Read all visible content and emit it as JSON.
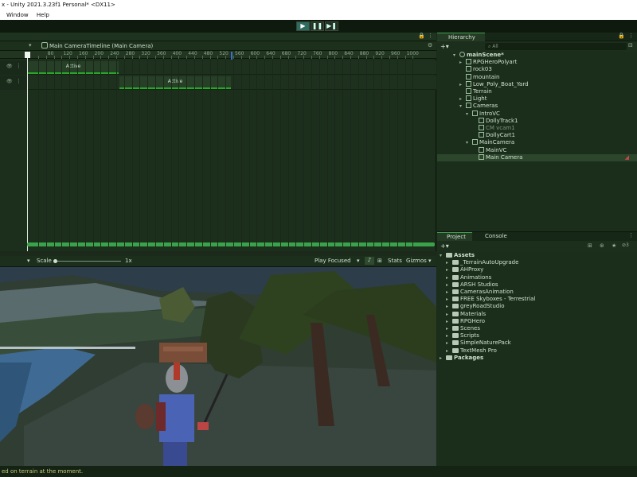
{
  "window": {
    "title": "x - Unity 2021.3.23f1 Personal* <DX11>"
  },
  "menu": {
    "items": [
      "Window",
      "Help"
    ]
  },
  "toolbar": {
    "play_icon": "play-icon",
    "pause_icon": "pause-icon",
    "step_icon": "step-icon"
  },
  "timeline": {
    "title": "Main CameraTimeline (Main Camera)",
    "ruler_ticks": [
      "40",
      "60",
      "80",
      "100",
      "120",
      "140",
      "160",
      "180",
      "200",
      "220",
      "240",
      "260",
      "280",
      "300",
      "320",
      "340",
      "360",
      "380",
      "400",
      "420",
      "440",
      "460",
      "480",
      "500",
      "520",
      "540",
      "560",
      "580",
      "600",
      "620",
      "640",
      "660",
      "680",
      "700",
      "720",
      "740",
      "760",
      "780",
      "800",
      "820",
      "840",
      "860",
      "880",
      "900",
      "920",
      "940",
      "960",
      "980",
      "1000",
      "1020"
    ],
    "tracks": [
      {
        "clip_label": "Active"
      },
      {
        "clip_label": "Active"
      }
    ]
  },
  "hierarchy": {
    "tab_label": "Hierarchy",
    "search_placeholder": "All",
    "items": [
      {
        "label": "mainScene*",
        "depth": 0,
        "expanded": true
      },
      {
        "label": "RPGHeroPolyart",
        "depth": 1,
        "expanded": false
      },
      {
        "label": "rock03",
        "depth": 1
      },
      {
        "label": "mountain",
        "depth": 1
      },
      {
        "label": "Low_Poly_Boat_Yard",
        "depth": 1,
        "expanded": false
      },
      {
        "label": "Terrain",
        "depth": 1
      },
      {
        "label": "Light",
        "depth": 1,
        "expanded": false
      },
      {
        "label": "Cameras",
        "depth": 1,
        "expanded": true
      },
      {
        "label": "IntroVC",
        "depth": 2,
        "expanded": true
      },
      {
        "label": "DollyTrack1",
        "depth": 3
      },
      {
        "label": "CM vcam1",
        "depth": 3,
        "dim": true
      },
      {
        "label": "DollyCart1",
        "depth": 3
      },
      {
        "label": "MainCamera",
        "depth": 2,
        "expanded": true
      },
      {
        "label": "MainVC",
        "depth": 3
      },
      {
        "label": "Main Camera",
        "depth": 3,
        "selected": true
      }
    ]
  },
  "project": {
    "tabs": [
      "Project",
      "Console"
    ],
    "items": [
      {
        "label": "Assets",
        "depth": 0,
        "bold": true
      },
      {
        "label": "_TerrainAutoUpgrade",
        "depth": 1
      },
      {
        "label": "AHProxy",
        "depth": 1
      },
      {
        "label": "Animations",
        "depth": 1
      },
      {
        "label": "ARSH Studios",
        "depth": 1
      },
      {
        "label": "CamerasAnimation",
        "depth": 1
      },
      {
        "label": "FREE Skyboxes - Terrestrial",
        "depth": 1
      },
      {
        "label": "greyRoadStudio",
        "depth": 1
      },
      {
        "label": "Materials",
        "depth": 1
      },
      {
        "label": "RPGHero",
        "depth": 1
      },
      {
        "label": "Scenes",
        "depth": 1
      },
      {
        "label": "Scripts",
        "depth": 1
      },
      {
        "label": "SimpleNaturePack",
        "depth": 1
      },
      {
        "label": "TextMesh Pro",
        "depth": 1
      },
      {
        "label": "Packages",
        "depth": 0,
        "bold": true
      }
    ],
    "badge": "3"
  },
  "gameview": {
    "scale_label": "Scale",
    "scale_value": "1x",
    "play_focused": "Play Focused",
    "stats": "Stats",
    "gizmos": "Gizmos"
  },
  "status": {
    "message": "ed on terrain at the moment."
  }
}
